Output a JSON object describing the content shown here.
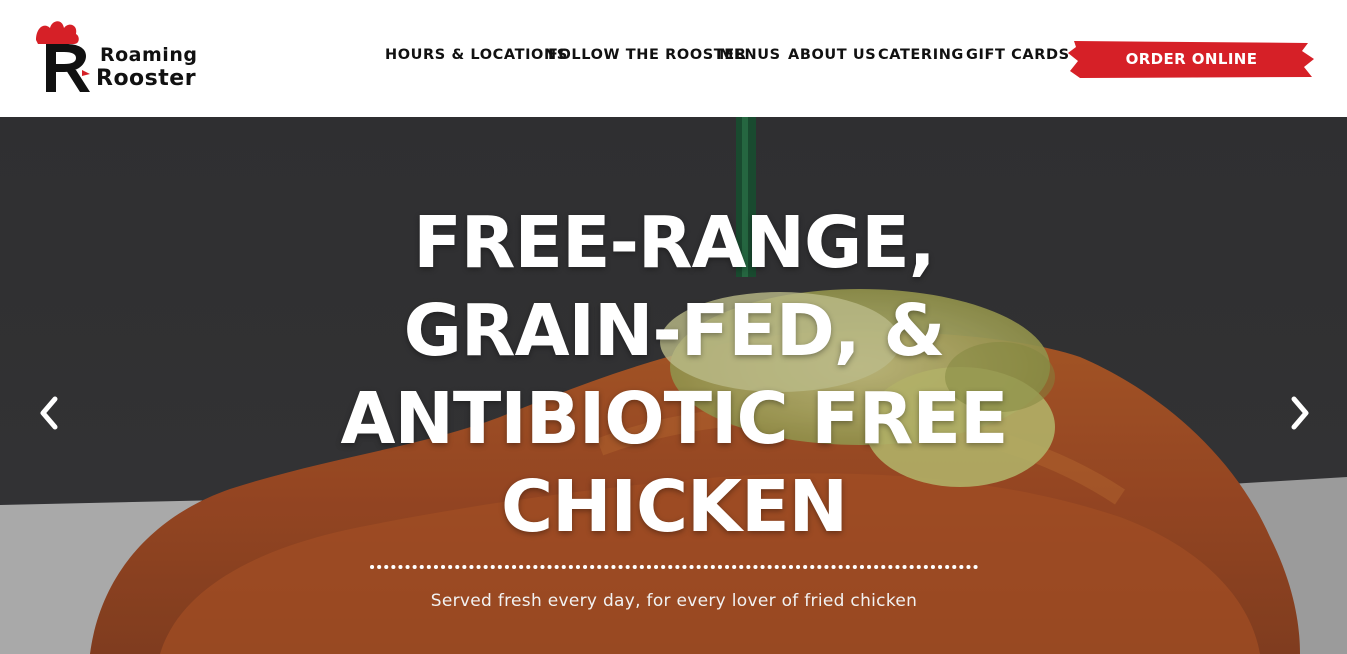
{
  "brand": {
    "name_line1": "Roaming",
    "name_line2": "Rooster",
    "accent_color": "#d62027"
  },
  "nav": {
    "items": [
      {
        "label": "HOURS & LOCATIONS"
      },
      {
        "label": "FOLLOW THE ROOSTER"
      },
      {
        "label": "MENUS"
      },
      {
        "label": "ABOUT US"
      },
      {
        "label": "CATERING"
      },
      {
        "label": "GIFT CARDS"
      }
    ],
    "order_label": "ORDER ONLINE"
  },
  "hero": {
    "headline_lines": [
      "FREE-RANGE,",
      "GRAIN-FED, &",
      "ANTIBIOTIC FREE",
      "CHICKEN"
    ],
    "tagline": "Served fresh every day, for every lover of fried chicken",
    "prev_icon": "chevron-left-icon",
    "next_icon": "chevron-right-icon"
  }
}
